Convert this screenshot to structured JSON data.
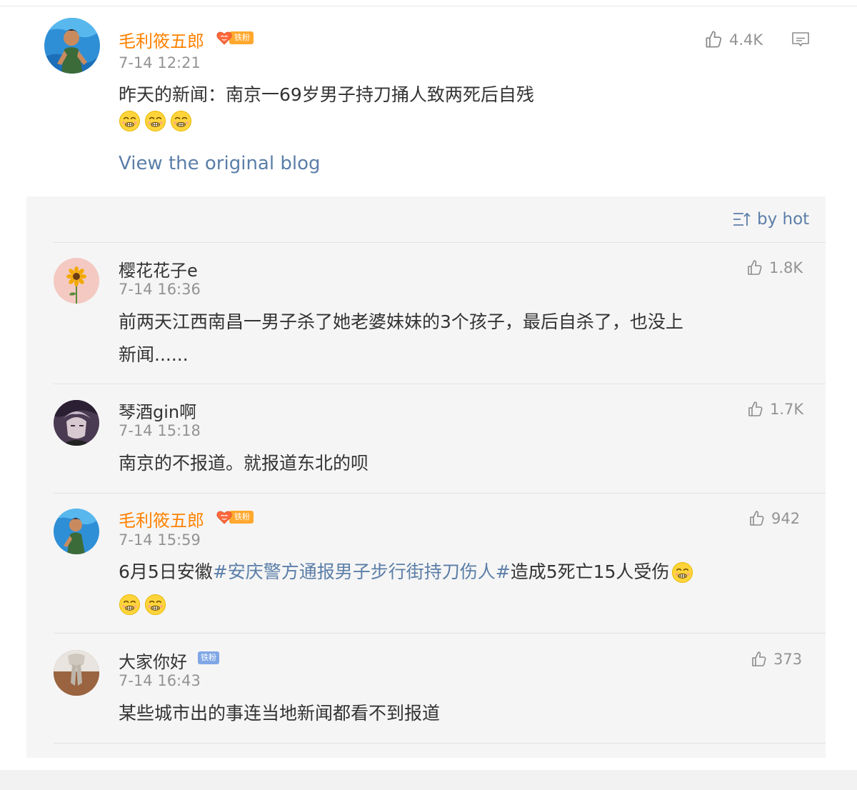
{
  "post": {
    "username": "毛利筱五郎",
    "badge": "铁粉",
    "time": "7-14 12:21",
    "likes": "4.4K",
    "text": "昨天的新闻：南京一69岁男子持刀捅人致两死后自残",
    "view_original": "View the original blog"
  },
  "sort_label": "by hot",
  "comments": [
    {
      "username": "樱花花子e",
      "time": "7-14 16:36",
      "likes": "1.8K",
      "text_line1": "前两天江西南昌一男子杀了她老婆妹妹的3个孩子，最后自杀了，也没上",
      "text_line2": "新闻......"
    },
    {
      "username": "琴酒gin啊",
      "time": "7-14 15:18",
      "likes": "1.7K",
      "text": "南京的不报道。就报道东北的呗"
    },
    {
      "username": "毛利筱五郎",
      "badge": "铁粉",
      "time": "7-14 15:59",
      "likes": "942",
      "text_before": "6月5日安徽",
      "hashtag": "#安庆警方通报男子步行街持刀伤人#",
      "text_after": "造成5死亡15人受伤"
    },
    {
      "username": "大家你好",
      "badge": "铁粉",
      "time": "7-14 16:43",
      "likes": "373",
      "text": "某些城市出的事连当地新闻都看不到报道"
    }
  ],
  "colors": {
    "username_orange": "#ff8200",
    "link_blue": "#5b7ea8",
    "meta_gray": "#939393",
    "panel_bg": "#f5f5f5"
  },
  "icons": [
    "thumbs-up-icon",
    "comment-icon",
    "sort-icon",
    "zipper-mouth-emoji",
    "heart-badge-icon"
  ]
}
